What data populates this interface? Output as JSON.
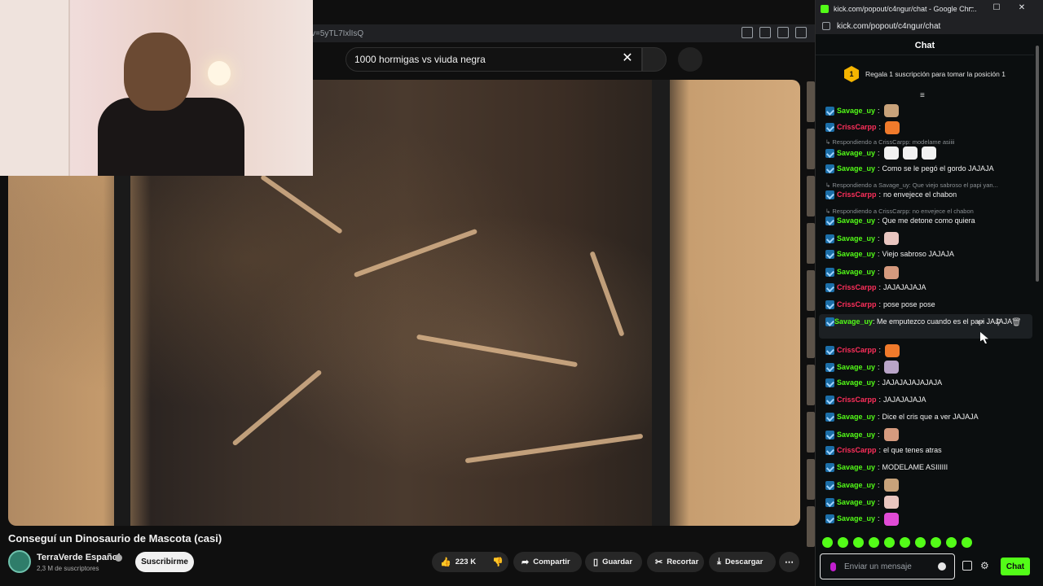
{
  "youtube": {
    "url_fragment": "v=5yTL7IxlIsQ",
    "search_query": "1000 hormigas vs viuda negra",
    "video_title": "Conseguí un Dinosaurio de Mascota (casi)",
    "channel_name": "TerraVerde Español",
    "subscribers": "2,3 M de suscriptores",
    "subscribe_label": "Suscribirme",
    "like_count": "223 K",
    "share_label": "Compartir",
    "save_label": "Guardar",
    "clip_label": "Recortar",
    "download_label": "Descargar"
  },
  "kick": {
    "window_title": "kick.com/popout/c4ngur/chat - Google Chr...",
    "url": "kick.com/popout/c4ngur/chat",
    "chat_title": "Chat",
    "pinned_rank": "1",
    "pinned_text": "Regala 1 suscripción para tomar la posición 1",
    "input_placeholder": "Enviar un mensaje",
    "send_label": "Chat",
    "colors": {
      "accent": "#53fc18",
      "savage": "#53fc18",
      "criss": "#ff2f5b"
    },
    "messages": [
      {
        "type": "msg",
        "user": "Savage_uy",
        "text": "",
        "emote": "#c8a27a"
      },
      {
        "type": "msg",
        "user": "CrissCarpp",
        "text": "",
        "emote": "#f07a2b"
      },
      {
        "type": "reply",
        "text": "Respondiendo a CrissCarpp: modelame asiiii"
      },
      {
        "type": "msg",
        "user": "Savage_uy",
        "text": "",
        "emote": "#f1f1f1",
        "emote_count": 3
      },
      {
        "type": "msg",
        "user": "Savage_uy",
        "text": "Como se le pegó el gordo JAJAJA"
      },
      {
        "type": "reply",
        "text": "Respondiendo a Savage_uy: Que viejo sabroso el papi yan..."
      },
      {
        "type": "msg",
        "user": "CrissCarpp",
        "text": "no envejece el chabon"
      },
      {
        "type": "reply",
        "text": "Respondiendo a CrissCarpp: no envejece el chabon"
      },
      {
        "type": "msg",
        "user": "Savage_uy",
        "text": "Que me detone como quiera"
      },
      {
        "type": "msg",
        "user": "Savage_uy",
        "text": "",
        "emote": "#e9c6c0"
      },
      {
        "type": "msg",
        "user": "Savage_uy",
        "text": "Viejo sabroso JAJAJA"
      },
      {
        "type": "msg",
        "user": "Savage_uy",
        "text": "",
        "emote": "#d59a7e"
      },
      {
        "type": "msg",
        "user": "CrissCarpp",
        "text": "JAJAJAJAJA"
      },
      {
        "type": "msg",
        "user": "CrissCarpp",
        "text": "pose pose pose"
      },
      {
        "type": "msg",
        "user": "Savage_uy",
        "text": "Me emputezco cuando es el papi JAJAJA",
        "wrap": true
      },
      {
        "type": "msg",
        "user": "CrissCarpp",
        "text": "",
        "emote": "#f07a2b"
      },
      {
        "type": "msg",
        "user": "Savage_uy",
        "text": "",
        "emote": "#b9a5c8"
      },
      {
        "type": "msg",
        "user": "Savage_uy",
        "text": "JAJAJAJAJAJAJA"
      },
      {
        "type": "msg",
        "user": "CrissCarpp",
        "text": "JAJAJAJAJA"
      },
      {
        "type": "msg",
        "user": "Savage_uy",
        "text": "Dice el cris que a ver JAJAJA"
      },
      {
        "type": "msg",
        "user": "Savage_uy",
        "text": "",
        "emote": "#d59a7e"
      },
      {
        "type": "msg",
        "user": "CrissCarpp",
        "text": "el que tenes atras"
      },
      {
        "type": "msg",
        "user": "Savage_uy",
        "text": "MODELAME ASIIIIII"
      },
      {
        "type": "msg",
        "user": "Savage_uy",
        "text": "",
        "emote": "#c8a27a"
      },
      {
        "type": "msg",
        "user": "Savage_uy",
        "text": "",
        "emote": "#e9c6c0"
      },
      {
        "type": "msg",
        "user": "Savage_uy",
        "text": "",
        "emote": "#e04bd6"
      }
    ]
  }
}
